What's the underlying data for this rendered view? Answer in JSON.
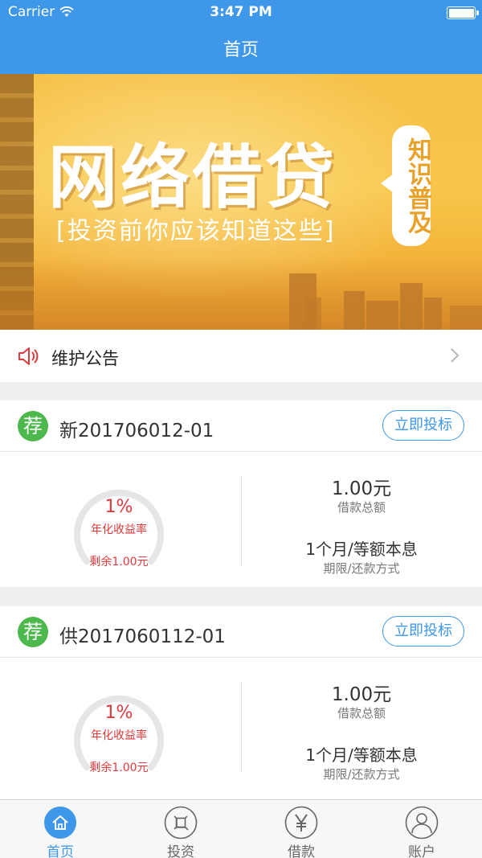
{
  "status_bar": {
    "carrier": "Carrier",
    "time": "3:47 PM"
  },
  "nav": {
    "title": "首页"
  },
  "banner": {
    "title": "网络借贷",
    "subtitle": "[投资前你应该知道这些]",
    "tag": "知识普及"
  },
  "notice": {
    "label": "维护公告",
    "icon": "speaker-icon"
  },
  "products": [
    {
      "badge": "荐",
      "name": "新201706012-01",
      "button": "立即投标",
      "rate": "1%",
      "rate_label": "年化收益率",
      "remaining": "剩余1.00元",
      "rate_progress": 0.01,
      "amount": "1.00元",
      "amount_label": "借款总额",
      "term": "1个月/等额本息",
      "term_label": "期限/还款方式"
    },
    {
      "badge": "荐",
      "name": "供2017060112-01",
      "button": "立即投标",
      "rate": "1%",
      "rate_label": "年化收益率",
      "remaining": "剩余1.00元",
      "rate_progress": 0.01,
      "amount": "1.00元",
      "amount_label": "借款总额",
      "term": "1个月/等额本息",
      "term_label": "期限/还款方式"
    }
  ],
  "tabs": [
    {
      "label": "首页",
      "icon": "home-icon",
      "active": true
    },
    {
      "label": "投资",
      "icon": "invest-icon",
      "active": false
    },
    {
      "label": "借款",
      "icon": "yen-icon",
      "active": false
    },
    {
      "label": "账户",
      "icon": "user-icon",
      "active": false
    }
  ],
  "colors": {
    "primary": "#3e97e8",
    "accent_red": "#e0393b",
    "badge_green": "#4db84c",
    "banner_orange": "#f6c24a"
  }
}
